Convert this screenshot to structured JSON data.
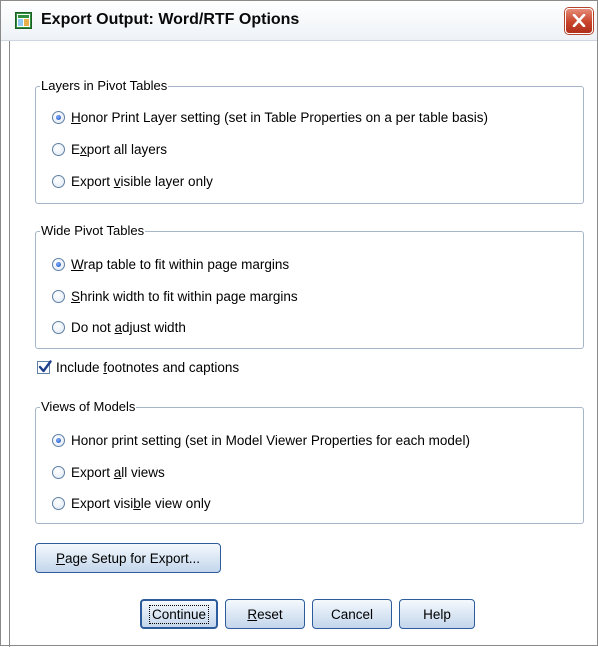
{
  "window": {
    "title": "Export Output: Word/RTF Options",
    "close_icon": "close-icon",
    "app_icon": "spss-output-icon"
  },
  "layers_group": {
    "legend": "Layers in Pivot Tables",
    "options": [
      {
        "pre": "",
        "key": "H",
        "post": "onor Print Layer setting (set in Table Properties on a per table basis)",
        "checked": true
      },
      {
        "pre": "E",
        "key": "x",
        "post": "port all layers",
        "checked": false
      },
      {
        "pre": "Export ",
        "key": "v",
        "post": "isible layer only",
        "checked": false
      }
    ]
  },
  "wide_group": {
    "legend": "Wide Pivot Tables",
    "options": [
      {
        "pre": "",
        "key": "W",
        "post": "rap table to fit within page margins",
        "checked": true
      },
      {
        "pre": "",
        "key": "S",
        "post": "hrink width to fit within page margins",
        "checked": false
      },
      {
        "pre": "Do not ",
        "key": "a",
        "post": "djust width",
        "checked": false
      }
    ]
  },
  "footnotes": {
    "pre": "Include ",
    "key": "f",
    "post": "ootnotes and captions",
    "checked": true
  },
  "views_group": {
    "legend": "Views of Models",
    "options": [
      {
        "pre": "Honor print setting (set in Model Viewer Properties for each model)",
        "key": "",
        "post": "",
        "checked": true
      },
      {
        "pre": "Export ",
        "key": "a",
        "post": "ll views",
        "checked": false
      },
      {
        "pre": "Export visi",
        "key": "b",
        "post": "le view only",
        "checked": false
      }
    ]
  },
  "buttons": {
    "page_setup": {
      "pre": "",
      "key": "P",
      "post": "age Setup for Export..."
    },
    "continue": "Continue",
    "reset": {
      "pre": "",
      "key": "R",
      "post": "eset"
    },
    "cancel": "Cancel",
    "help": "Help"
  },
  "colors": {
    "group_border": "#a7b5c8",
    "button_border": "#2d5c9c",
    "close_red": "#c8432a"
  }
}
